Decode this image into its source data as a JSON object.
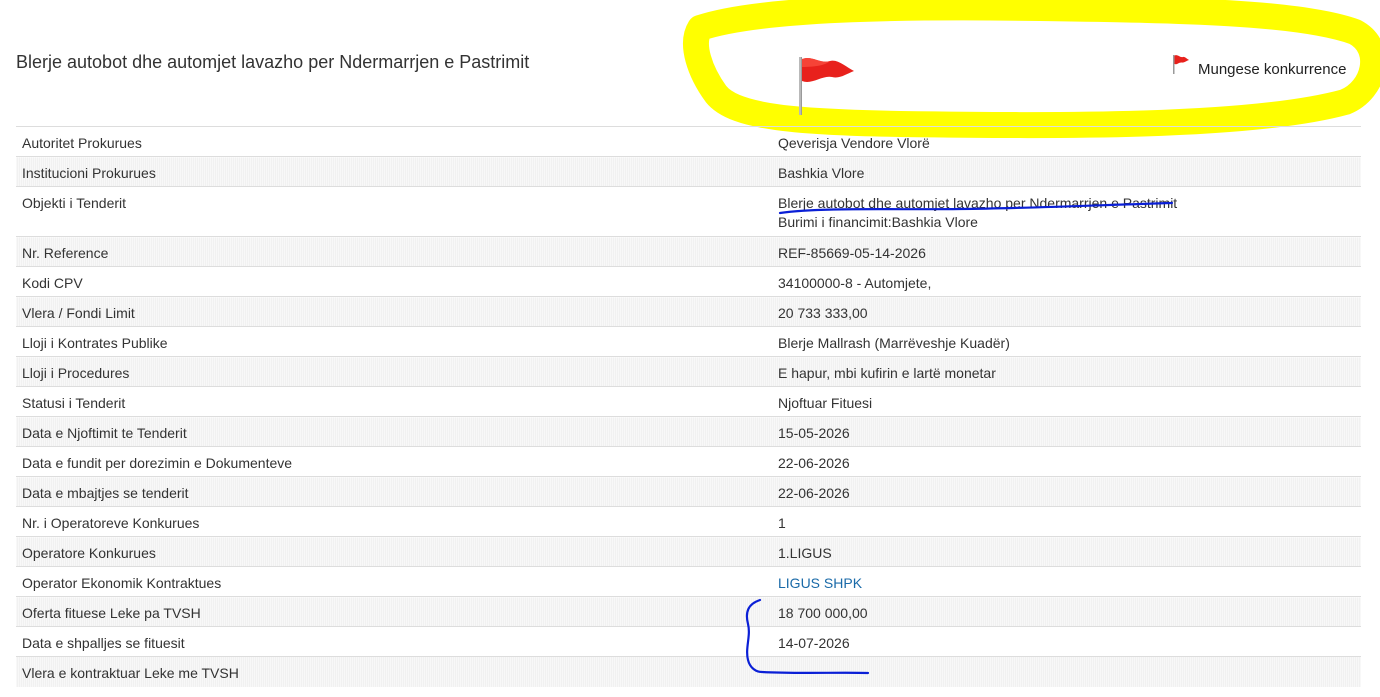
{
  "page": {
    "title": "Blerje autobot dhe automjet lavazho per Ndermarrjen e Pastrimit"
  },
  "legend": {
    "flag_icon": "red-flag-icon",
    "label": "Mungese konkurrence",
    "flag_color": "#e8211c",
    "highlight_color": "#ffff00",
    "annotation_color": "#0a1fd6"
  },
  "details": {
    "rows": [
      {
        "label": "Autoritet Prokurues",
        "value": "Qeverisja Vendore Vlorë"
      },
      {
        "label": "Institucioni Prokurues",
        "value": "Bashkia Vlore"
      },
      {
        "label": "Objekti i Tenderit",
        "value": "Blerje autobot dhe automjet lavazho per Ndermarrjen e Pastrimit",
        "extra": "Burimi i financimit:Bashkia Vlore"
      },
      {
        "label": "Nr. Reference",
        "value": "REF-85669-05-14-2026"
      },
      {
        "label": "Kodi CPV",
        "value": "34100000-8 - Automjete,"
      },
      {
        "label": "Vlera / Fondi Limit",
        "value": "20 733 333,00"
      },
      {
        "label": "Lloji i Kontrates Publike",
        "value": "Blerje Mallrash (Marrëveshje Kuadër)"
      },
      {
        "label": "Lloji i Procedures",
        "value": "E hapur, mbi kufirin e lartë monetar"
      },
      {
        "label": "Statusi i Tenderit",
        "value": "Njoftuar Fituesi"
      },
      {
        "label": "Data e Njoftimit te Tenderit",
        "value": "15-05-2026"
      },
      {
        "label": "Data e fundit per dorezimin e Dokumenteve",
        "value": "22-06-2026"
      },
      {
        "label": "Data e mbajtjes se tenderit",
        "value": "22-06-2026"
      },
      {
        "label": "Nr. i Operatoreve Konkurues",
        "value": "1"
      },
      {
        "label": "Operatore Konkurues",
        "value": "1.LIGUS"
      },
      {
        "label": "Operator Ekonomik Kontraktues",
        "value": "LIGUS SHPK"
      },
      {
        "label": "Oferta fituese Leke pa TVSH",
        "value": "18 700 000,00"
      },
      {
        "label": "Data e shpalljes se fituesit",
        "value": "14-07-2026"
      },
      {
        "label": "Vlera e kontraktuar Leke me TVSH",
        "value": ""
      }
    ]
  }
}
